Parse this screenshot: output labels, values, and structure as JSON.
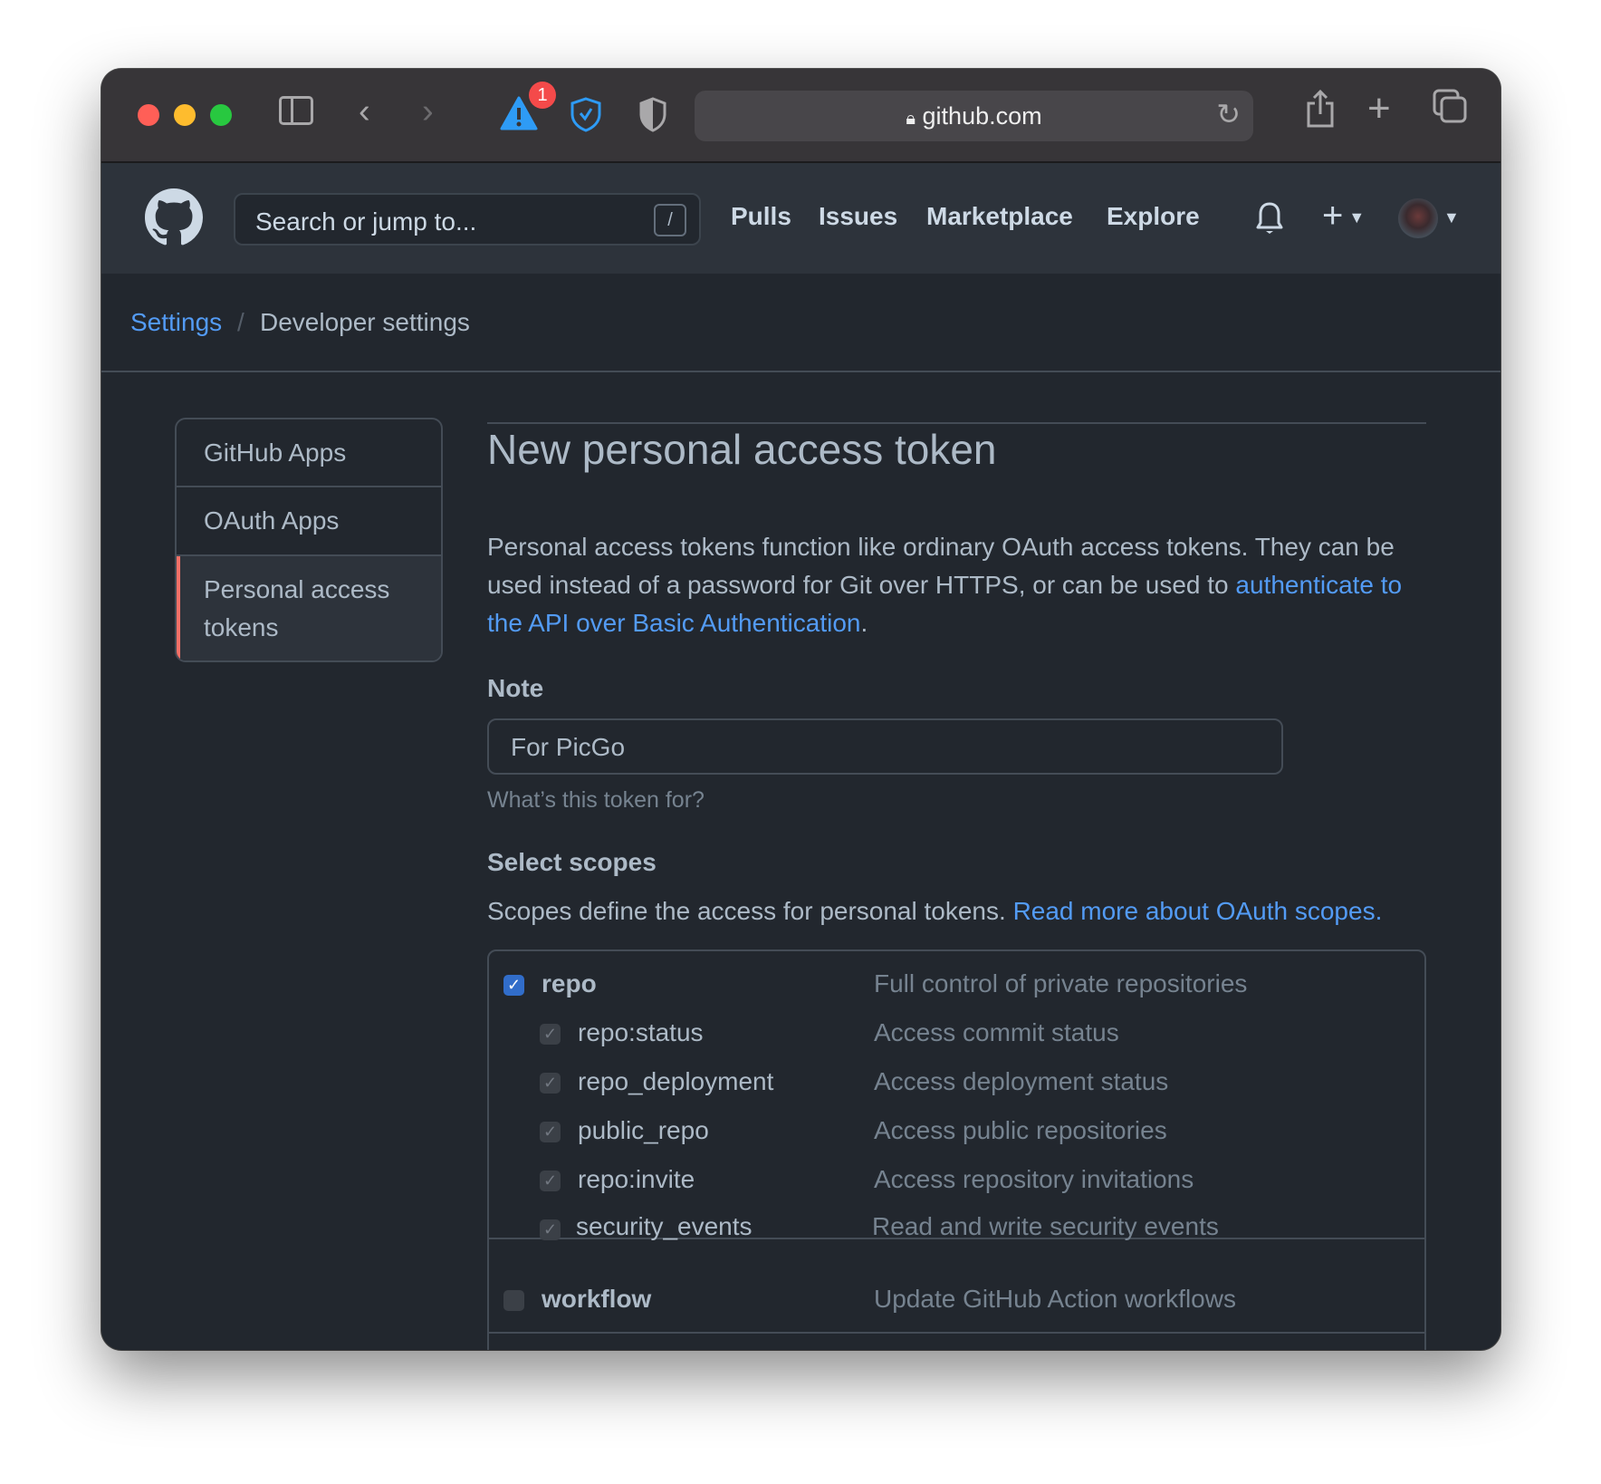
{
  "browser": {
    "url": "github.com",
    "notification_badge": "1",
    "icons": [
      "sidebar-icon",
      "back-icon",
      "forward-icon",
      "warning-icon",
      "shield-check-icon",
      "half-shield-icon",
      "lock-icon",
      "reload-icon",
      "share-icon",
      "new-tab-icon",
      "tabs-overview-icon"
    ],
    "traffic_lights": {
      "close": "#ff5f57",
      "minimize": "#febc2e",
      "maximize": "#28c840"
    }
  },
  "header": {
    "search_placeholder": "Search or jump to...",
    "search_shortcut": "/",
    "nav": [
      "Pulls",
      "Issues",
      "Marketplace",
      "Explore"
    ]
  },
  "breadcrumb": {
    "parent": "Settings",
    "separator": "/",
    "current": "Developer settings"
  },
  "sidebar": {
    "items": [
      {
        "label": "GitHub Apps"
      },
      {
        "label": "OAuth Apps"
      },
      {
        "label": "Personal access tokens",
        "selected": true
      }
    ]
  },
  "main": {
    "title": "New personal access token",
    "intro_text": "Personal access tokens function like ordinary OAuth access tokens. They can be used instead of a password for Git over HTTPS, or can be used to ",
    "intro_link": "authenticate to the API over Basic Authentication",
    "intro_end": ".",
    "note_label": "Note",
    "note_value": "For PicGo",
    "note_hint": "What’s this token for?",
    "scopes_heading": "Select scopes",
    "scopes_text": "Scopes define the access for personal tokens. ",
    "scopes_link": "Read more about OAuth scopes.",
    "scopes": [
      {
        "name": "repo",
        "desc": "Full control of private repositories",
        "checked": true
      },
      {
        "name": "repo:status",
        "desc": "Access commit status",
        "checked": true
      },
      {
        "name": "repo_deployment",
        "desc": "Access deployment status",
        "checked": true
      },
      {
        "name": "public_repo",
        "desc": "Access public repositories",
        "checked": true
      },
      {
        "name": "repo:invite",
        "desc": "Access repository invitations",
        "checked": true
      },
      {
        "name": "security_events",
        "desc": "Read and write security events",
        "checked": true
      },
      {
        "name": "workflow",
        "desc": "Update GitHub Action workflows",
        "checked": false
      }
    ]
  },
  "colors": {
    "accent": "#539bf5",
    "selected_marker": "#f47067",
    "background": "#22272e",
    "header": "#2d333b"
  }
}
